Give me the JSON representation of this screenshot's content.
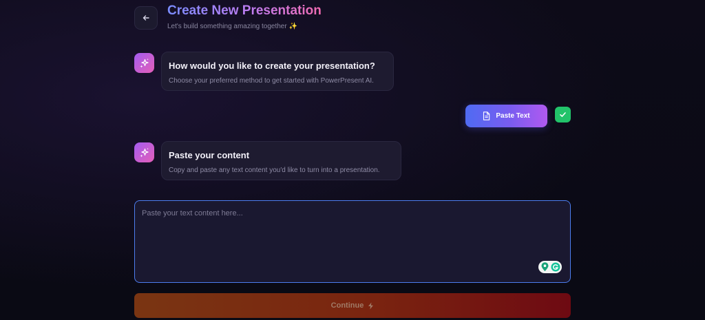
{
  "header": {
    "title": "Create New Presentation",
    "subtitle": "Let's build something amazing together ✨",
    "back_icon": "arrow-left-icon"
  },
  "conversation": {
    "method_question": {
      "title": "How would you like to create your presentation?",
      "description": "Choose your preferred method to get started with PowerPresent AI."
    },
    "selected_choice": {
      "label": "Paste Text",
      "icon": "document-icon",
      "status_icon": "checkmark-icon"
    },
    "paste_prompt": {
      "title": "Paste your content",
      "description": "Copy and paste any text content you'd like to turn into a presentation."
    }
  },
  "text_input": {
    "placeholder": "Paste your text content here...",
    "value": ""
  },
  "continue_button": {
    "label": "Continue",
    "icon": "lightning-icon"
  },
  "colors": {
    "accent_start": "#4f6bf2",
    "accent_end": "#b05af0",
    "avatar_start": "#a35cf0",
    "avatar_end": "#e45fb8",
    "success": "#22c36a",
    "input_border": "#4d7ef0",
    "continue_start": "#7a3512",
    "continue_end": "#6e0a12"
  }
}
